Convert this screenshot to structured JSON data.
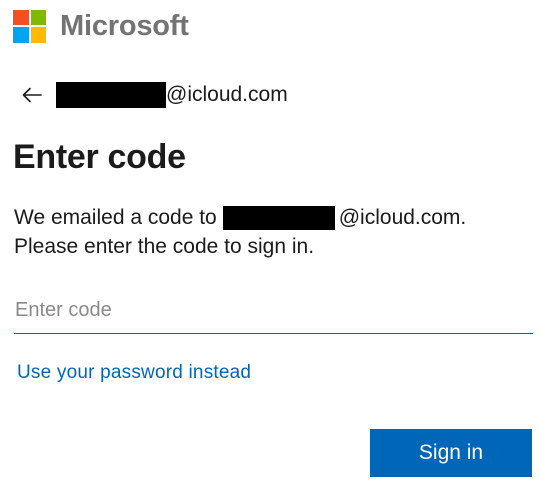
{
  "brand": {
    "name": "Microsoft",
    "logo_colors": {
      "red": "#f25022",
      "green": "#7fba00",
      "blue": "#00a4ef",
      "yellow": "#ffb900"
    }
  },
  "identity": {
    "back_icon": "arrow-left-icon",
    "email_domain": "@icloud.com"
  },
  "title": "Enter code",
  "description": {
    "line1_prefix": "We emailed a code to",
    "line1_suffix": "@icloud.com.",
    "line2": "Please enter the code to sign in."
  },
  "code_input": {
    "value": "",
    "placeholder": "Enter code"
  },
  "alt_link": "Use your password instead",
  "submit_label": "Sign in",
  "colors": {
    "accent": "#0067b8",
    "text": "#1b1b1b",
    "logo_text": "#737373"
  }
}
